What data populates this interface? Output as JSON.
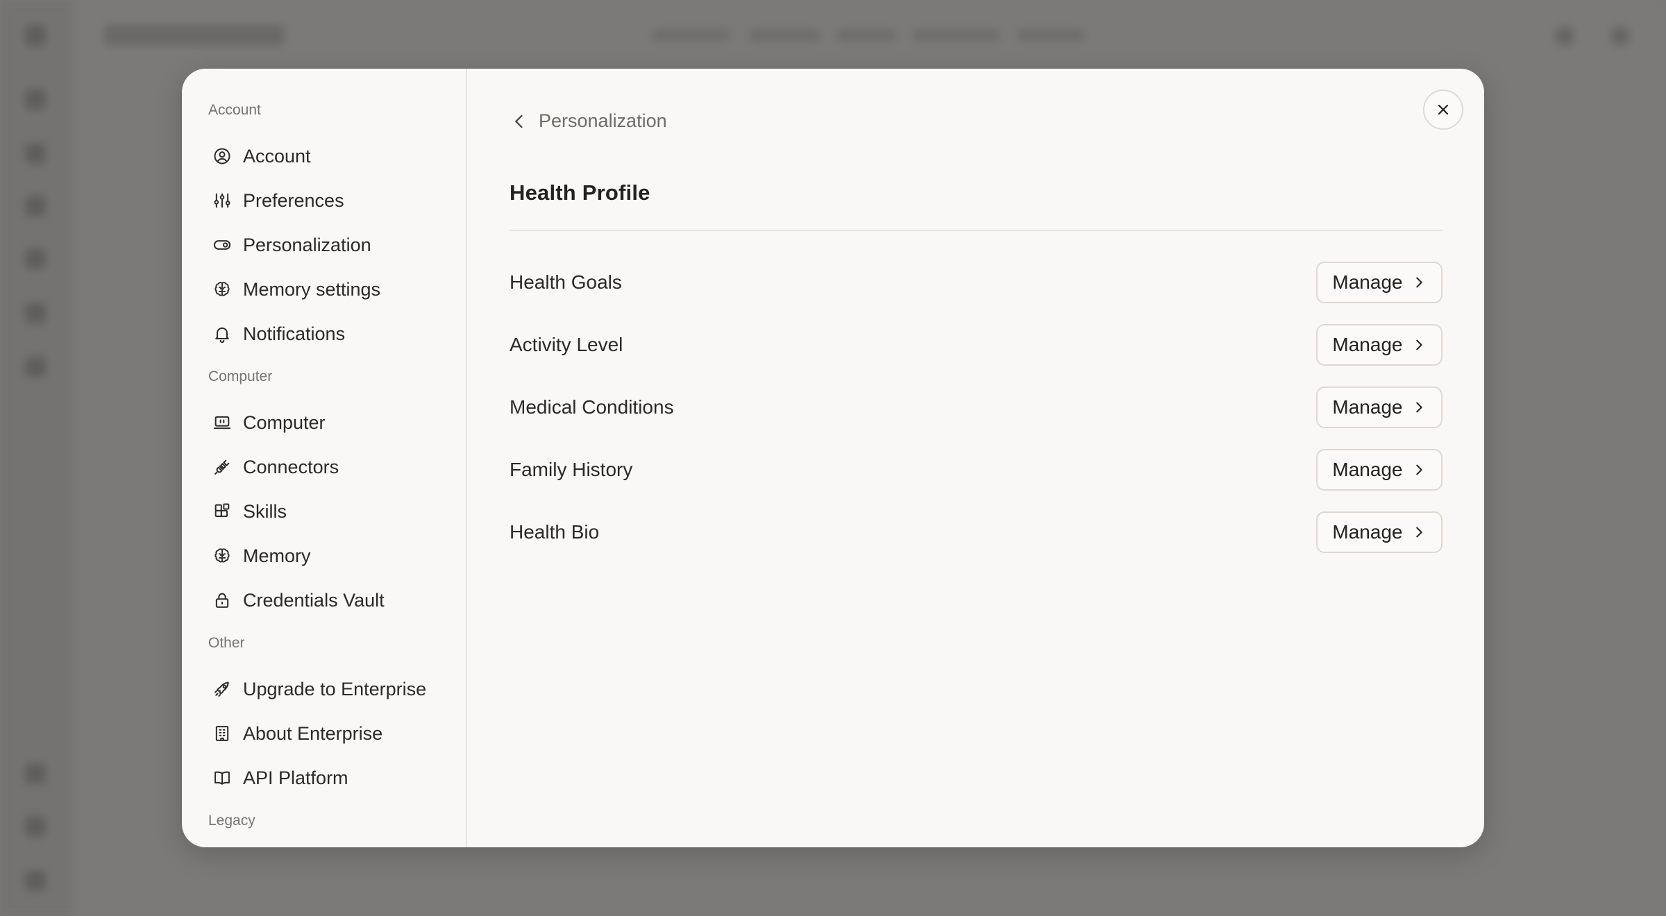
{
  "background": {
    "top_nav": [
      "Discover",
      "Finance",
      "Health",
      "Academic",
      "Patents"
    ]
  },
  "sidebar": {
    "sections": [
      {
        "label": "Account",
        "items": [
          {
            "label": "Account",
            "icon": "user-circle-icon"
          },
          {
            "label": "Preferences",
            "icon": "sliders-icon"
          },
          {
            "label": "Personalization",
            "icon": "toggle-icon"
          },
          {
            "label": "Memory settings",
            "icon": "brain-icon"
          },
          {
            "label": "Notifications",
            "icon": "bell-icon"
          }
        ]
      },
      {
        "label": "Computer",
        "items": [
          {
            "label": "Computer",
            "icon": "laptop-icon"
          },
          {
            "label": "Connectors",
            "icon": "plug-icon"
          },
          {
            "label": "Skills",
            "icon": "blocks-icon"
          },
          {
            "label": "Memory",
            "icon": "brain-icon"
          },
          {
            "label": "Credentials Vault",
            "icon": "lock-icon"
          }
        ]
      },
      {
        "label": "Other",
        "items": [
          {
            "label": "Upgrade to Enterprise",
            "icon": "rocket-icon"
          },
          {
            "label": "About Enterprise",
            "icon": "building-icon"
          },
          {
            "label": "API Platform",
            "icon": "book-icon"
          }
        ]
      },
      {
        "label": "Legacy",
        "items": []
      }
    ]
  },
  "content": {
    "breadcrumb": "Personalization",
    "title": "Health Profile",
    "rows": [
      {
        "label": "Health Goals",
        "button": "Manage"
      },
      {
        "label": "Activity Level",
        "button": "Manage"
      },
      {
        "label": "Medical Conditions",
        "button": "Manage"
      },
      {
        "label": "Family History",
        "button": "Manage"
      },
      {
        "label": "Health Bio",
        "button": "Manage"
      }
    ]
  },
  "colors": {
    "modal_bg": "#f9f8f6",
    "overlay": "#7a7977",
    "text": "#2b2a27",
    "muted": "#76746f",
    "border": "#dcd9d3"
  }
}
